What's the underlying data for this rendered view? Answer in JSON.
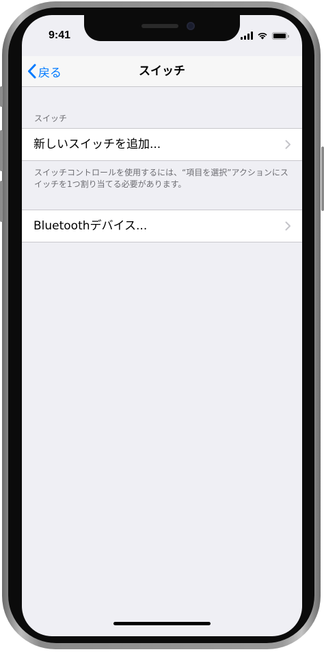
{
  "status_bar": {
    "time": "9:41"
  },
  "nav": {
    "back_label": "戻る",
    "title": "スイッチ"
  },
  "section": {
    "header": "スイッチ"
  },
  "rows": [
    {
      "label": "新しいスイッチを追加..."
    },
    {
      "label": "Bluetoothデバイス..."
    }
  ],
  "footer": {
    "text": "スイッチコントロールを使用するには、“項目を選択”アクションにスイッチを1つ割り当てる必要があります。"
  },
  "icons": {
    "back": "chevron-left-icon",
    "disclosure": "chevron-right-icon",
    "signal": "cellular-signal-icon",
    "wifi": "wifi-icon",
    "battery": "battery-icon"
  },
  "colors": {
    "tint": "#007aff",
    "grouped_background": "#efeff4",
    "secondary_text": "#6d6d72",
    "separator": "#c8c7cc"
  }
}
